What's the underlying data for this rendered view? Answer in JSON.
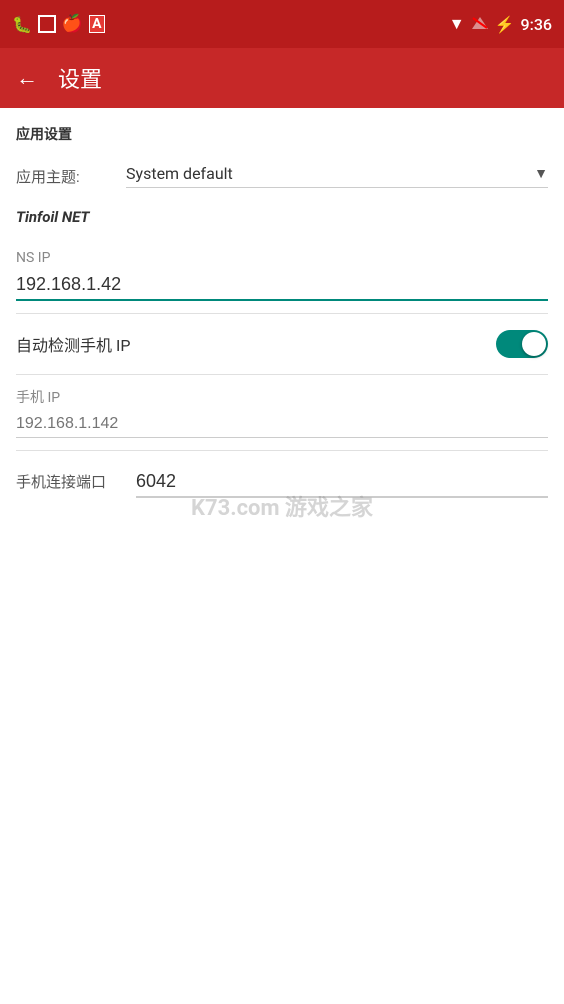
{
  "statusBar": {
    "time": "9:36",
    "icons": {
      "wifi": "▼",
      "signal": "▲",
      "battery": "🔋"
    }
  },
  "appBar": {
    "backLabel": "←",
    "title": "设置"
  },
  "content": {
    "sectionHeader": "应用设置",
    "themeLabel": "应用主题:",
    "themeValue": "System default",
    "tinfoilLabel": "Tinfoil NET",
    "nsIpLabel": "NS IP",
    "nsIpValue": "192.168.1.42",
    "nsIpPlaceholder": "",
    "autoDetectLabel": "自动检测手机 IP",
    "autoDetectEnabled": true,
    "phoneIpLabel": "手机 IP",
    "phoneIpPlaceholder": "192.168.1.142",
    "portLabel": "手机连接端口",
    "portValue": "6042",
    "watermark": "K73.com 游戏之家"
  }
}
